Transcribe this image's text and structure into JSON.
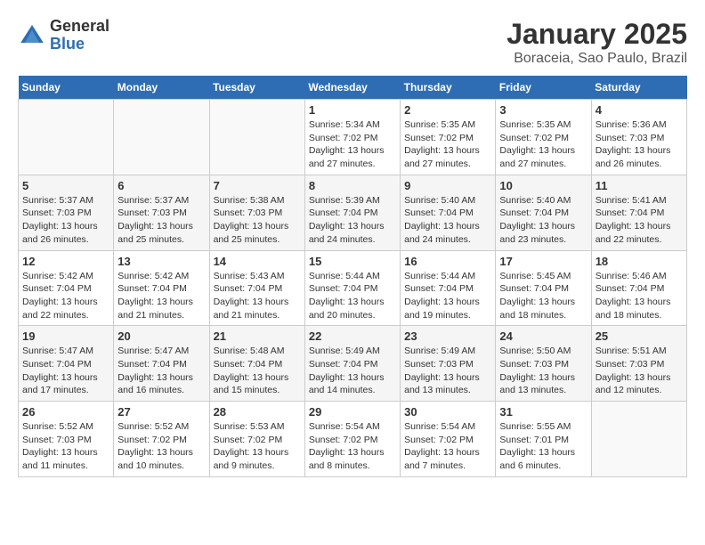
{
  "header": {
    "logo_general": "General",
    "logo_blue": "Blue",
    "title": "January 2025",
    "subtitle": "Boraceia, Sao Paulo, Brazil"
  },
  "weekdays": [
    "Sunday",
    "Monday",
    "Tuesday",
    "Wednesday",
    "Thursday",
    "Friday",
    "Saturday"
  ],
  "weeks": [
    [
      {
        "day": "",
        "sunrise": "",
        "sunset": "",
        "daylight": ""
      },
      {
        "day": "",
        "sunrise": "",
        "sunset": "",
        "daylight": ""
      },
      {
        "day": "",
        "sunrise": "",
        "sunset": "",
        "daylight": ""
      },
      {
        "day": "1",
        "sunrise": "Sunrise: 5:34 AM",
        "sunset": "Sunset: 7:02 PM",
        "daylight": "Daylight: 13 hours and 27 minutes."
      },
      {
        "day": "2",
        "sunrise": "Sunrise: 5:35 AM",
        "sunset": "Sunset: 7:02 PM",
        "daylight": "Daylight: 13 hours and 27 minutes."
      },
      {
        "day": "3",
        "sunrise": "Sunrise: 5:35 AM",
        "sunset": "Sunset: 7:02 PM",
        "daylight": "Daylight: 13 hours and 27 minutes."
      },
      {
        "day": "4",
        "sunrise": "Sunrise: 5:36 AM",
        "sunset": "Sunset: 7:03 PM",
        "daylight": "Daylight: 13 hours and 26 minutes."
      }
    ],
    [
      {
        "day": "5",
        "sunrise": "Sunrise: 5:37 AM",
        "sunset": "Sunset: 7:03 PM",
        "daylight": "Daylight: 13 hours and 26 minutes."
      },
      {
        "day": "6",
        "sunrise": "Sunrise: 5:37 AM",
        "sunset": "Sunset: 7:03 PM",
        "daylight": "Daylight: 13 hours and 25 minutes."
      },
      {
        "day": "7",
        "sunrise": "Sunrise: 5:38 AM",
        "sunset": "Sunset: 7:03 PM",
        "daylight": "Daylight: 13 hours and 25 minutes."
      },
      {
        "day": "8",
        "sunrise": "Sunrise: 5:39 AM",
        "sunset": "Sunset: 7:04 PM",
        "daylight": "Daylight: 13 hours and 24 minutes."
      },
      {
        "day": "9",
        "sunrise": "Sunrise: 5:40 AM",
        "sunset": "Sunset: 7:04 PM",
        "daylight": "Daylight: 13 hours and 24 minutes."
      },
      {
        "day": "10",
        "sunrise": "Sunrise: 5:40 AM",
        "sunset": "Sunset: 7:04 PM",
        "daylight": "Daylight: 13 hours and 23 minutes."
      },
      {
        "day": "11",
        "sunrise": "Sunrise: 5:41 AM",
        "sunset": "Sunset: 7:04 PM",
        "daylight": "Daylight: 13 hours and 22 minutes."
      }
    ],
    [
      {
        "day": "12",
        "sunrise": "Sunrise: 5:42 AM",
        "sunset": "Sunset: 7:04 PM",
        "daylight": "Daylight: 13 hours and 22 minutes."
      },
      {
        "day": "13",
        "sunrise": "Sunrise: 5:42 AM",
        "sunset": "Sunset: 7:04 PM",
        "daylight": "Daylight: 13 hours and 21 minutes."
      },
      {
        "day": "14",
        "sunrise": "Sunrise: 5:43 AM",
        "sunset": "Sunset: 7:04 PM",
        "daylight": "Daylight: 13 hours and 21 minutes."
      },
      {
        "day": "15",
        "sunrise": "Sunrise: 5:44 AM",
        "sunset": "Sunset: 7:04 PM",
        "daylight": "Daylight: 13 hours and 20 minutes."
      },
      {
        "day": "16",
        "sunrise": "Sunrise: 5:44 AM",
        "sunset": "Sunset: 7:04 PM",
        "daylight": "Daylight: 13 hours and 19 minutes."
      },
      {
        "day": "17",
        "sunrise": "Sunrise: 5:45 AM",
        "sunset": "Sunset: 7:04 PM",
        "daylight": "Daylight: 13 hours and 18 minutes."
      },
      {
        "day": "18",
        "sunrise": "Sunrise: 5:46 AM",
        "sunset": "Sunset: 7:04 PM",
        "daylight": "Daylight: 13 hours and 18 minutes."
      }
    ],
    [
      {
        "day": "19",
        "sunrise": "Sunrise: 5:47 AM",
        "sunset": "Sunset: 7:04 PM",
        "daylight": "Daylight: 13 hours and 17 minutes."
      },
      {
        "day": "20",
        "sunrise": "Sunrise: 5:47 AM",
        "sunset": "Sunset: 7:04 PM",
        "daylight": "Daylight: 13 hours and 16 minutes."
      },
      {
        "day": "21",
        "sunrise": "Sunrise: 5:48 AM",
        "sunset": "Sunset: 7:04 PM",
        "daylight": "Daylight: 13 hours and 15 minutes."
      },
      {
        "day": "22",
        "sunrise": "Sunrise: 5:49 AM",
        "sunset": "Sunset: 7:04 PM",
        "daylight": "Daylight: 13 hours and 14 minutes."
      },
      {
        "day": "23",
        "sunrise": "Sunrise: 5:49 AM",
        "sunset": "Sunset: 7:03 PM",
        "daylight": "Daylight: 13 hours and 13 minutes."
      },
      {
        "day": "24",
        "sunrise": "Sunrise: 5:50 AM",
        "sunset": "Sunset: 7:03 PM",
        "daylight": "Daylight: 13 hours and 13 minutes."
      },
      {
        "day": "25",
        "sunrise": "Sunrise: 5:51 AM",
        "sunset": "Sunset: 7:03 PM",
        "daylight": "Daylight: 13 hours and 12 minutes."
      }
    ],
    [
      {
        "day": "26",
        "sunrise": "Sunrise: 5:52 AM",
        "sunset": "Sunset: 7:03 PM",
        "daylight": "Daylight: 13 hours and 11 minutes."
      },
      {
        "day": "27",
        "sunrise": "Sunrise: 5:52 AM",
        "sunset": "Sunset: 7:02 PM",
        "daylight": "Daylight: 13 hours and 10 minutes."
      },
      {
        "day": "28",
        "sunrise": "Sunrise: 5:53 AM",
        "sunset": "Sunset: 7:02 PM",
        "daylight": "Daylight: 13 hours and 9 minutes."
      },
      {
        "day": "29",
        "sunrise": "Sunrise: 5:54 AM",
        "sunset": "Sunset: 7:02 PM",
        "daylight": "Daylight: 13 hours and 8 minutes."
      },
      {
        "day": "30",
        "sunrise": "Sunrise: 5:54 AM",
        "sunset": "Sunset: 7:02 PM",
        "daylight": "Daylight: 13 hours and 7 minutes."
      },
      {
        "day": "31",
        "sunrise": "Sunrise: 5:55 AM",
        "sunset": "Sunset: 7:01 PM",
        "daylight": "Daylight: 13 hours and 6 minutes."
      },
      {
        "day": "",
        "sunrise": "",
        "sunset": "",
        "daylight": ""
      }
    ]
  ]
}
